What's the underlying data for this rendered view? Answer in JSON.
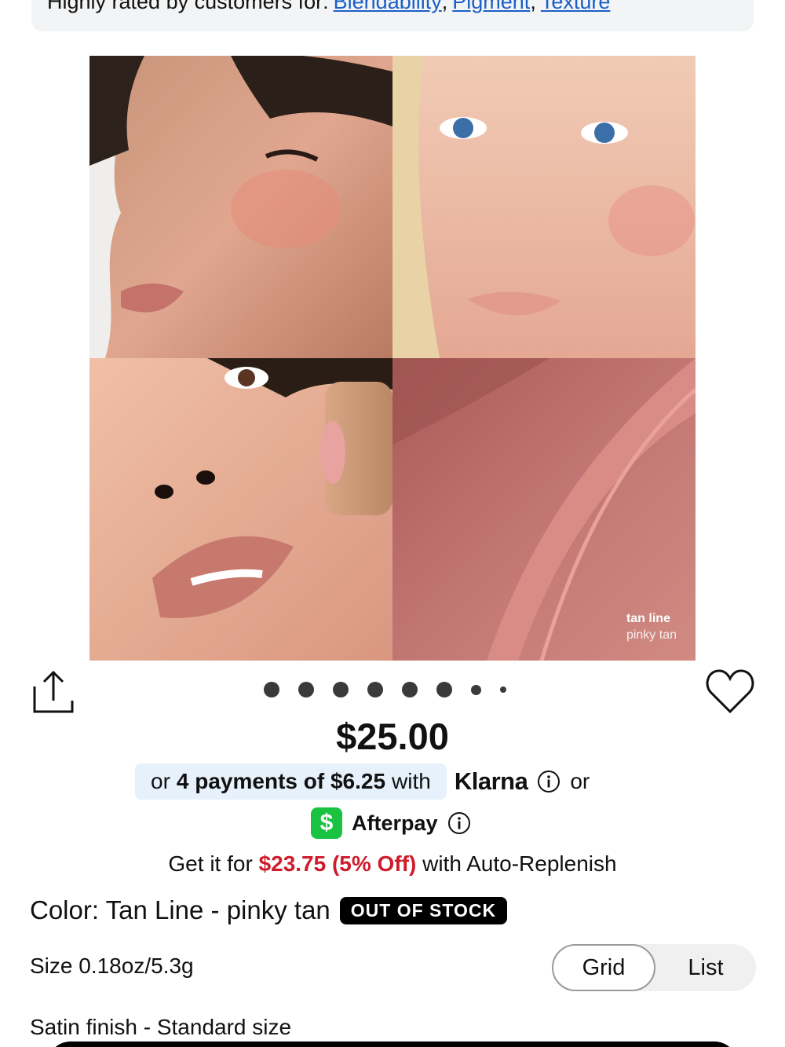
{
  "rated_banner": {
    "prefix": "Highly rated by customers for:",
    "tags": [
      "Blendability",
      "Pigment",
      "Texture"
    ]
  },
  "gallery": {
    "swatch_shade": "tan line",
    "swatch_sub": "pinky tan"
  },
  "carousel": {
    "dot_count": 8,
    "active_index": 0
  },
  "price": "$25.00",
  "klarna": {
    "or": "or",
    "payments": "4 payments of $6.25",
    "with": "with",
    "brand": "Klarna",
    "or_after": "or"
  },
  "afterpay": {
    "icon_glyph": "$",
    "brand": "Afterpay"
  },
  "replenish": {
    "prefix": "Get it for",
    "sale": "$23.75 (5% Off)",
    "suffix": "with Auto-Replenish"
  },
  "color": {
    "label": "Color: Tan Line - pinky tan",
    "badge": "OUT OF STOCK"
  },
  "size": "Size 0.18oz/5.3g",
  "view_toggle": {
    "grid": "Grid",
    "list": "List",
    "selected": "Grid"
  },
  "finish": "Satin finish - Standard size",
  "colors": {
    "link": "#1a5fc7",
    "sale": "#cf1c2c",
    "klarna_bg": "#e6f1fb",
    "cashapp": "#19c341"
  }
}
